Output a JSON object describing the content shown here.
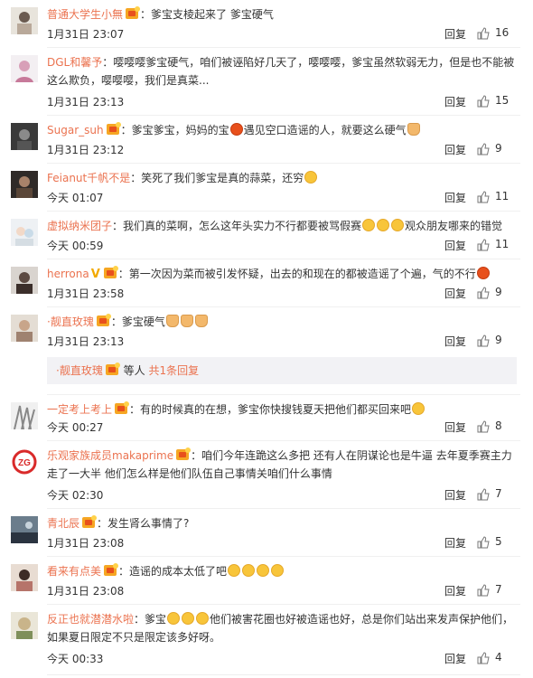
{
  "reply_label": "回复",
  "icons": {
    "like": "thumbs-up-icon",
    "vip": "vip-crown-icon",
    "verified": "verified-v-icon"
  },
  "colors": {
    "username": "#eb7350",
    "text": "#333333",
    "subreply_bg": "#f2f2f5"
  },
  "comments": [
    {
      "user": "普通大学生小無",
      "badge": "vip",
      "text": "爹宝支棱起来了 爹宝硬气",
      "time": "1月31日 23:07",
      "likes": "16"
    },
    {
      "user": "DGL和馨予",
      "badge": "",
      "text": "嘤嘤嘤爹宝硬气，咱们被诬陷好几天了，嘤嘤嘤，爹宝虽然软弱无力，但是也不能被这么欺负，嘤嘤嘤，我们是真菜...",
      "time": "1月31日 23:13",
      "likes": "15"
    },
    {
      "user": "Sugar_suh",
      "badge": "vip",
      "text_a": "爹宝爹宝，妈妈的宝",
      "text_b": "遇见空口造谣的人，就要这么硬气",
      "time": "1月31日 23:12",
      "likes": "9"
    },
    {
      "user": "Feianut千帆不是",
      "badge": "",
      "text": "笑死了我们爹宝是真的蒜菜，还穷",
      "time": "今天 01:07",
      "likes": "11"
    },
    {
      "user": "虚拟纳米团子",
      "badge": "",
      "text_a": "我们真的菜啊，怎么这年头实力不行都要被骂假赛",
      "text_b": "观众朋友哪来的错觉",
      "time": "今天 00:59",
      "likes": "11"
    },
    {
      "user": "herrona",
      "badge": "v+vip",
      "text": "第一次因为菜而被引发怀疑，出去的和现在的都被造谣了个遍，气的不行",
      "time": "1月31日 23:58",
      "likes": "9"
    },
    {
      "user": "·靓直玫瑰",
      "badge": "vip",
      "text": "爹宝硬气",
      "time": "1月31日 23:13",
      "likes": "9"
    },
    {
      "user": "一定考上考上",
      "badge": "vip",
      "text": "有的时候真的在想，爹宝你快搜钱夏天把他们都买回来吧",
      "time": "今天 00:27",
      "likes": "8"
    },
    {
      "user": "乐观家族成员makaprime",
      "badge": "vip",
      "text": "咱们今年连跪这么多把 还有人在阴谋论也是牛逼 去年夏季赛主力走了一大半 他们怎么样是他们队伍自己事情关咱们什么事情",
      "time": "今天 02:30",
      "likes": "7"
    },
    {
      "user": "青北辰",
      "badge": "vip",
      "text": "发生肾么事情了?",
      "time": "1月31日 23:08",
      "likes": "5"
    },
    {
      "user": "看来有点美",
      "badge": "vip",
      "text": "造谣的成本太低了吧",
      "time": "1月31日 23:08",
      "likes": "7"
    },
    {
      "user": "反正也就潜潜水啦",
      "badge": "",
      "text_a": "爹宝",
      "text_b": "他们被害花圈也好被造谣也好，总是你们站出来发声保护他们，如果夏日限定不只是限定该多好呀。",
      "time": "今天 00:33",
      "likes": "4"
    }
  ],
  "subreply": {
    "user": "·靓直玫瑰",
    "text": "等人",
    "more": "共1条回复"
  }
}
